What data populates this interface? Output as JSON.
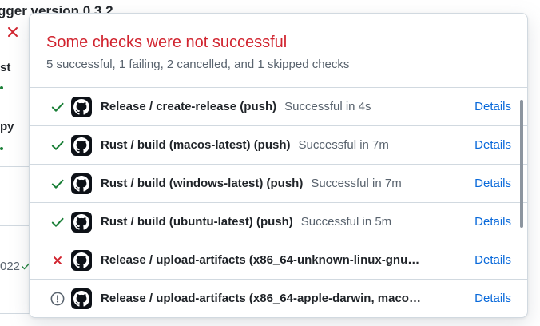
{
  "background": {
    "title": "gger version 0.3.2",
    "frag_1": "st",
    "frag_2": "py",
    "frag_3": "022"
  },
  "popover": {
    "title": "Some checks were not successful",
    "summary": "5 successful, 1 failing, 2 cancelled, and 1 skipped checks",
    "details_label": "Details"
  },
  "checks": [
    {
      "name": "Release / create-release (push)",
      "duration": "Successful in 4s",
      "status": "success",
      "details": "Details"
    },
    {
      "name": "Rust / build (macos-latest) (push)",
      "duration": "Successful in 7m",
      "status": "success",
      "details": "Details"
    },
    {
      "name": "Rust / build (windows-latest) (push)",
      "duration": "Successful in 7m",
      "status": "success",
      "details": "Details"
    },
    {
      "name": "Rust / build (ubuntu-latest) (push)",
      "duration": "Successful in 5m",
      "status": "success",
      "details": "Details"
    },
    {
      "name": "Release / upload-artifacts (x86_64-unknown-linux-gnu…",
      "duration": "",
      "status": "failure",
      "details": "Details"
    },
    {
      "name": "Release / upload-artifacts (x86_64-apple-darwin, maco…",
      "duration": "",
      "status": "cancelled",
      "details": "Details"
    }
  ],
  "colors": {
    "success": "#1a7f37",
    "failure": "#d1242f",
    "cancelled": "#59636e",
    "link": "#0969da"
  }
}
